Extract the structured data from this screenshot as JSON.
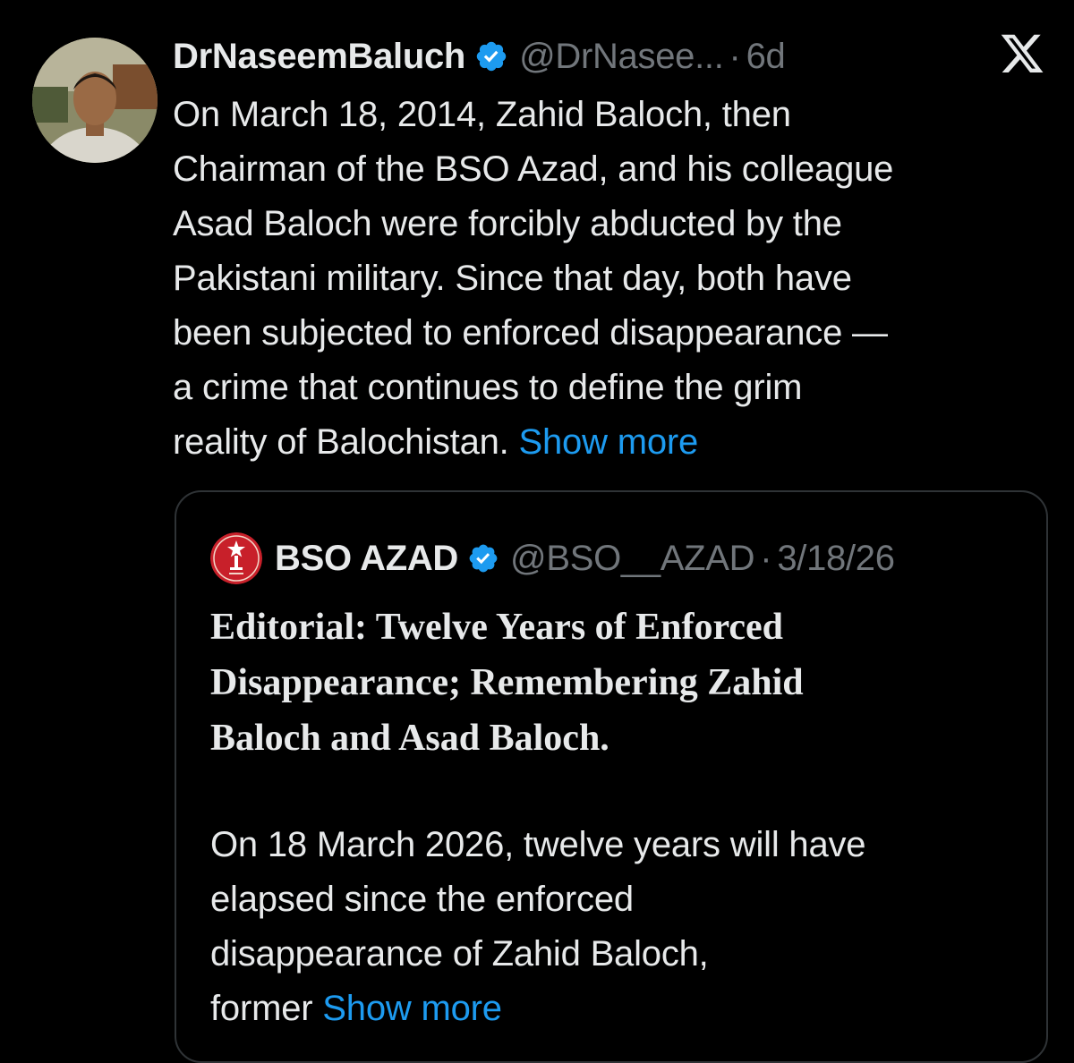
{
  "tweet": {
    "author_name": "DrNaseemBaluch",
    "handle": "@DrNasee...",
    "separator": "·",
    "time": "6d",
    "text_lines": [
      "On March 18, 2014, Zahid Baloch, then",
      "Chairman of the BSO Azad, and his colleague",
      "Asad Baloch were forcibly abducted by the",
      "Pakistani military. Since that day, both have",
      "been subjected to enforced disappearance —",
      "a crime that continues to define the grim",
      "reality of Balochistan."
    ],
    "show_more": "Show more"
  },
  "quoted": {
    "author_name": "BSO AZAD",
    "handle": "@BSO__AZAD",
    "separator": "·",
    "time": "3/18/26",
    "headline_lines": [
      "Editorial: Twelve Years of Enforced",
      "Disappearance; Remembering Zahid",
      "Baloch and Asad Baloch."
    ],
    "body_lines": [
      "On 18 March 2026, twelve years will have",
      "elapsed since the enforced",
      "disappearance of Zahid Baloch,",
      "former"
    ],
    "show_more": "Show more"
  },
  "icons": {
    "verified": "verified-badge-icon",
    "platform": "x-logo-icon"
  },
  "colors": {
    "background": "#000000",
    "text": "#e7e9ea",
    "muted": "#71767b",
    "link": "#1d9bf0",
    "verified": "#1d9bf0",
    "border": "#2f3336"
  }
}
